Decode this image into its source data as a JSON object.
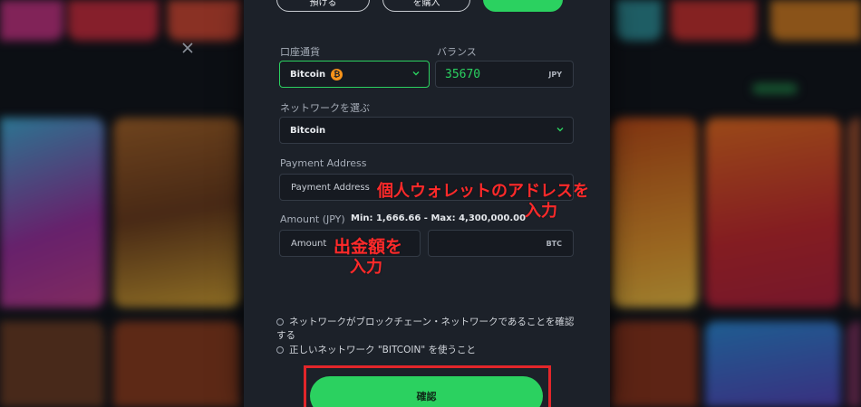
{
  "top_buttons": {
    "deposit_label": "預ける",
    "buy_label": "を購入"
  },
  "form": {
    "currency": {
      "label": "口座通貨",
      "value": "Bitcoin",
      "icon": "bitcoin-icon"
    },
    "balance": {
      "label": "バランス",
      "value": "35670",
      "unit": "JPY"
    },
    "network": {
      "label": "ネットワークを選ぶ",
      "value": "Bitcoin"
    },
    "payment_address": {
      "label": "Payment Address",
      "placeholder": "Payment Address"
    },
    "amount": {
      "label": "Amount (JPY)",
      "limits": "Min: 1,666.66 - Max: 4,300,000.00",
      "placeholder": "Amount",
      "btc_unit": "BTC"
    }
  },
  "annotations": {
    "address_line1": "個人ウォレットのアドレスを",
    "address_line2": "入力",
    "amount_line1": "出金額を",
    "amount_line2": "入力"
  },
  "checkboxes": [
    {
      "line1": "ネットワークがブロックチェーン・ネットワークであることを確認",
      "line2": "する"
    },
    {
      "line1": "正しいネットワーク \"BITCOIN\" を使うこと"
    }
  ],
  "confirm_label": "確認",
  "colors": {
    "accent": "#2bd160",
    "annotation": "#ff2a2a",
    "panel": "#1c2129"
  }
}
